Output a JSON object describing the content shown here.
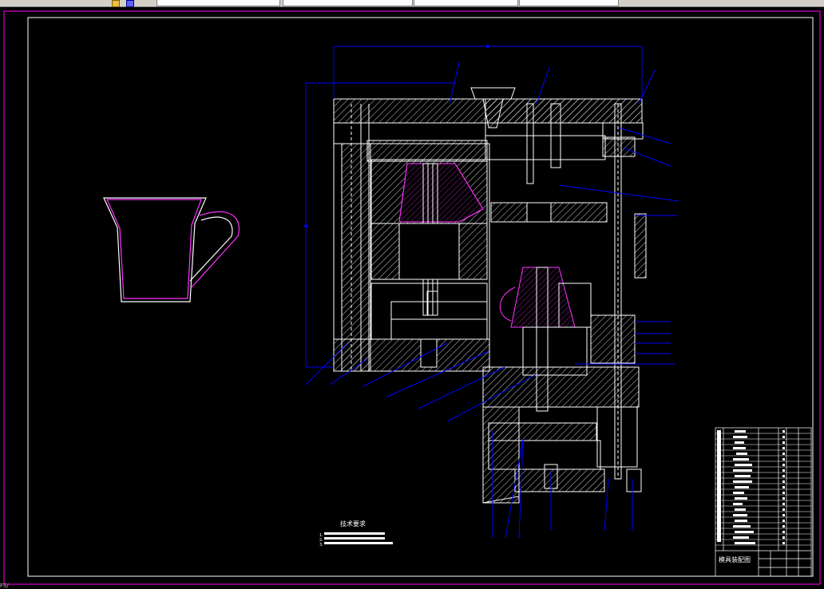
{
  "app": {
    "toolbar_fields": [
      "",
      "",
      "",
      "",
      ""
    ],
    "status_text": "FS/"
  },
  "drawing": {
    "tech_requirements": {
      "title": "技术要求",
      "items": [
        "1.",
        "2.",
        "3."
      ]
    },
    "title_block": {
      "title": "模具装配图"
    }
  },
  "colors": {
    "background": "#000000",
    "lines": "#ffffff",
    "frame": "#ff00ff",
    "leaders": "#0000ff",
    "hatch": "#ffffff",
    "product": "#ff33ff"
  },
  "icons": [
    "toolbar-icon-1",
    "toolbar-icon-2"
  ]
}
